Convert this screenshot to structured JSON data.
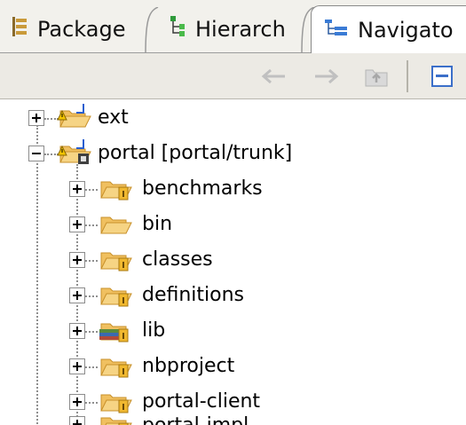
{
  "tabs": [
    {
      "label": "Package",
      "icon": "package-explorer-icon",
      "active": false
    },
    {
      "label": "Hierarch",
      "icon": "hierarchy-icon",
      "active": false
    },
    {
      "label": "Navigato",
      "icon": "navigator-icon",
      "active": true
    }
  ],
  "toolbar": {
    "buttons": [
      "back-arrow-icon",
      "forward-arrow-icon",
      "up-folder-icon",
      "collapse-all-icon"
    ]
  },
  "tree": {
    "items": [
      {
        "label": "ext",
        "icon": "shared-project-folder-icon",
        "expander": "plus",
        "depth": 0
      },
      {
        "label": "portal [portal/trunk]",
        "icon": "svn-project-folder-icon",
        "expander": "minus",
        "depth": 0
      },
      {
        "label": "benchmarks",
        "icon": "versioned-folder-icon",
        "expander": "plus",
        "depth": 1
      },
      {
        "label": "bin",
        "icon": "folder-icon",
        "expander": "plus",
        "depth": 1
      },
      {
        "label": "classes",
        "icon": "versioned-folder-icon",
        "expander": "plus",
        "depth": 1
      },
      {
        "label": "definitions",
        "icon": "versioned-folder-icon",
        "expander": "plus",
        "depth": 1
      },
      {
        "label": "lib",
        "icon": "library-folder-icon",
        "expander": "plus",
        "depth": 1
      },
      {
        "label": "nbproject",
        "icon": "versioned-folder-icon",
        "expander": "plus",
        "depth": 1
      },
      {
        "label": "portal-client",
        "icon": "versioned-folder-icon",
        "expander": "plus",
        "depth": 1
      },
      {
        "label": "portal-impl",
        "icon": "versioned-folder-icon",
        "expander": "plus",
        "depth": 1
      }
    ]
  },
  "colors": {
    "tab_bg": "#f2f1ec",
    "toolbar_bg": "#eceae4",
    "folder": "#f0c060",
    "folder_dark": "#c8902a"
  }
}
